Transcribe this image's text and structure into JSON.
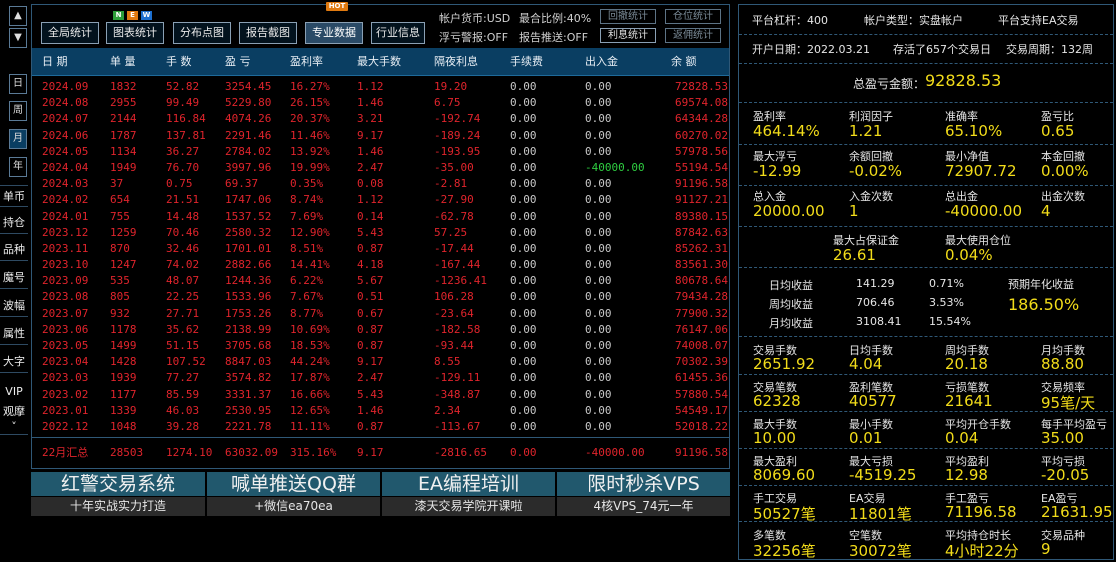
{
  "nav": {
    "up": "▲",
    "down": "▼",
    "periods": [
      "日",
      "周",
      "月",
      "年"
    ],
    "side": [
      "单币",
      "持仓",
      "品种",
      "魔号",
      "波幅",
      "属性",
      "大字",
      "VIP",
      "观摩"
    ],
    "more": "˅"
  },
  "toolbar": {
    "buttons": [
      "全局统计",
      "图表统计",
      "分布点图",
      "报告截图",
      "专业数据",
      "行业信息"
    ],
    "new_tag": "NEW",
    "hot_tag": "HOT",
    "currency": "帐户货币:USD",
    "max_ratio": "最合比例:40%",
    "float_alert": "浮亏警报:OFF",
    "report_push": "报告推送:OFF",
    "small_btns": [
      "回撤统计",
      "仓位统计",
      "利息统计",
      "返佣统计"
    ]
  },
  "table": {
    "headers": [
      "日 期",
      "单 量",
      "手 数",
      "盈 亏",
      "盈利率",
      "最大手数",
      "隔夜利息",
      "手续费",
      "出入金",
      "余 额"
    ],
    "rows": [
      [
        "2024.09",
        "1832",
        "52.82",
        "3254.45",
        "16.27%",
        "1.12",
        "19.20",
        "0.00",
        "0.00",
        "72828.53"
      ],
      [
        "2024.08",
        "2955",
        "99.49",
        "5229.80",
        "26.15%",
        "1.46",
        "6.75",
        "0.00",
        "0.00",
        "69574.08"
      ],
      [
        "2024.07",
        "2144",
        "116.84",
        "4074.26",
        "20.37%",
        "3.21",
        "-192.74",
        "0.00",
        "0.00",
        "64344.28"
      ],
      [
        "2024.06",
        "1787",
        "137.81",
        "2291.46",
        "11.46%",
        "9.17",
        "-189.24",
        "0.00",
        "0.00",
        "60270.02"
      ],
      [
        "2024.05",
        "1134",
        "36.27",
        "2784.02",
        "13.92%",
        "1.46",
        "-193.95",
        "0.00",
        "0.00",
        "57978.56"
      ],
      [
        "2024.04",
        "1949",
        "76.70",
        "3997.96",
        "19.99%",
        "2.47",
        "-35.00",
        "0.00",
        "-40000.00",
        "55194.54"
      ],
      [
        "2024.03",
        "37",
        "0.75",
        "69.37",
        "0.35%",
        "0.08",
        "-2.81",
        "0.00",
        "0.00",
        "91196.58"
      ],
      [
        "2024.02",
        "654",
        "21.51",
        "1747.06",
        "8.74%",
        "1.12",
        "-27.90",
        "0.00",
        "0.00",
        "91127.21"
      ],
      [
        "2024.01",
        "755",
        "14.48",
        "1537.52",
        "7.69%",
        "0.14",
        "-62.78",
        "0.00",
        "0.00",
        "89380.15"
      ],
      [
        "2023.12",
        "1259",
        "70.46",
        "2580.32",
        "12.90%",
        "5.43",
        "57.25",
        "0.00",
        "0.00",
        "87842.63"
      ],
      [
        "2023.11",
        "870",
        "32.46",
        "1701.01",
        "8.51%",
        "0.87",
        "-17.44",
        "0.00",
        "0.00",
        "85262.31"
      ],
      [
        "2023.10",
        "1247",
        "74.02",
        "2882.66",
        "14.41%",
        "4.18",
        "-167.44",
        "0.00",
        "0.00",
        "83561.30"
      ],
      [
        "2023.09",
        "535",
        "48.07",
        "1244.36",
        "6.22%",
        "5.67",
        "-1236.41",
        "0.00",
        "0.00",
        "80678.64"
      ],
      [
        "2023.08",
        "805",
        "22.25",
        "1533.96",
        "7.67%",
        "0.51",
        "106.28",
        "0.00",
        "0.00",
        "79434.28"
      ],
      [
        "2023.07",
        "932",
        "27.71",
        "1753.26",
        "8.77%",
        "0.67",
        "-23.64",
        "0.00",
        "0.00",
        "77900.32"
      ],
      [
        "2023.06",
        "1178",
        "35.62",
        "2138.99",
        "10.69%",
        "0.87",
        "-182.58",
        "0.00",
        "0.00",
        "76147.06"
      ],
      [
        "2023.05",
        "1499",
        "51.15",
        "3705.68",
        "18.53%",
        "0.87",
        "-93.44",
        "0.00",
        "0.00",
        "74008.07"
      ],
      [
        "2023.04",
        "1428",
        "107.52",
        "8847.03",
        "44.24%",
        "9.17",
        "8.55",
        "0.00",
        "0.00",
        "70302.39"
      ],
      [
        "2023.03",
        "1939",
        "77.27",
        "3574.82",
        "17.87%",
        "2.47",
        "-129.11",
        "0.00",
        "0.00",
        "61455.36"
      ],
      [
        "2023.02",
        "1177",
        "85.59",
        "3331.37",
        "16.66%",
        "5.43",
        "-348.87",
        "0.00",
        "0.00",
        "57880.54"
      ],
      [
        "2023.01",
        "1339",
        "46.03",
        "2530.95",
        "12.65%",
        "1.46",
        "2.34",
        "0.00",
        "0.00",
        "54549.17"
      ],
      [
        "2022.12",
        "1048",
        "39.28",
        "2221.78",
        "11.11%",
        "0.87",
        "-113.67",
        "0.00",
        "0.00",
        "52018.22"
      ]
    ],
    "summary": [
      "22月汇总",
      "28503",
      "1274.10",
      "63032.09",
      "315.16%",
      "9.17",
      "-2816.65",
      "0.00",
      "-40000.00",
      "91196.58"
    ],
    "deposit_color": "#2ecc40",
    "row_color": "#e0242c"
  },
  "ads": [
    {
      "title": "红警交易系统",
      "sub": "十年实战实力打造"
    },
    {
      "title": "喊单推送QQ群",
      "sub": "+微信ea70ea"
    },
    {
      "title": "EA编程培训",
      "sub": "漆天交易学院开课啦"
    },
    {
      "title": "限时秒杀VPS",
      "sub": "4核VPS_74元一年"
    }
  ],
  "right": {
    "leverage": "平台杠杆：400",
    "acct_type": "帐户类型：实盘帐户",
    "ea_support": "平台支持EA交易",
    "open_date": "开户日期：2022.03.21",
    "days": "存活了657个交易日",
    "cycle": "交易周期：132周",
    "total_label": "总盈亏金额：",
    "total_value": "92828.53",
    "g1": [
      {
        "l": "盈利率",
        "v": "464.14%"
      },
      {
        "l": "利润因子",
        "v": "1.21"
      },
      {
        "l": "准确率",
        "v": "65.10%"
      },
      {
        "l": "盈亏比",
        "v": "0.65"
      },
      {
        "l": "最大浮亏",
        "v": "-12.99"
      },
      {
        "l": "余额回撤",
        "v": "-0.02%"
      },
      {
        "l": "最小净值",
        "v": "72907.72"
      },
      {
        "l": "本金回撤",
        "v": "0.00%"
      },
      {
        "l": "总入金",
        "v": "20000.00"
      },
      {
        "l": "入金次数",
        "v": "1"
      },
      {
        "l": "总出金",
        "v": "-40000.00"
      },
      {
        "l": "出金次数",
        "v": "4"
      },
      {
        "l": "最大占保证金",
        "v": "26.61"
      },
      {
        "l": "最大使用仓位",
        "v": "0.04%"
      }
    ],
    "daily": {
      "rows": [
        [
          "日均收益",
          "141.29",
          "0.71%"
        ],
        [
          "周均收益",
          "706.46",
          "3.53%"
        ],
        [
          "月均收益",
          "3108.41",
          "15.54%"
        ]
      ],
      "annual_label": "预期年化收益",
      "annual_value": "186.50%"
    },
    "g2": [
      {
        "l": "交易手数",
        "v": "2651.92"
      },
      {
        "l": "日均手数",
        "v": "4.04"
      },
      {
        "l": "周均手数",
        "v": "20.18"
      },
      {
        "l": "月均手数",
        "v": "88.80"
      },
      {
        "l": "交易笔数",
        "v": "62328"
      },
      {
        "l": "盈利笔数",
        "v": "40577"
      },
      {
        "l": "亏损笔数",
        "v": "21641"
      },
      {
        "l": "交易频率",
        "v": "95笔/天"
      },
      {
        "l": "最大手数",
        "v": "10.00"
      },
      {
        "l": "最小手数",
        "v": "0.01"
      },
      {
        "l": "平均开仓手数",
        "v": "0.04"
      },
      {
        "l": "每手平均盈亏",
        "v": "35.00"
      },
      {
        "l": "最大盈利",
        "v": "8069.60"
      },
      {
        "l": "最大亏损",
        "v": "-4519.25"
      },
      {
        "l": "平均盈利",
        "v": "12.98"
      },
      {
        "l": "平均亏损",
        "v": "-20.05"
      },
      {
        "l": "手工交易",
        "v": "50527笔"
      },
      {
        "l": "EA交易",
        "v": "11801笔"
      },
      {
        "l": "手工盈亏",
        "v": "71196.58"
      },
      {
        "l": "EA盈亏",
        "v": "21631.95"
      },
      {
        "l": "多笔数",
        "v": "32256笔"
      },
      {
        "l": "空笔数",
        "v": "30072笔"
      },
      {
        "l": "平均持仓时长",
        "v": "4小时22分"
      },
      {
        "l": "交易品种",
        "v": "9"
      }
    ]
  }
}
